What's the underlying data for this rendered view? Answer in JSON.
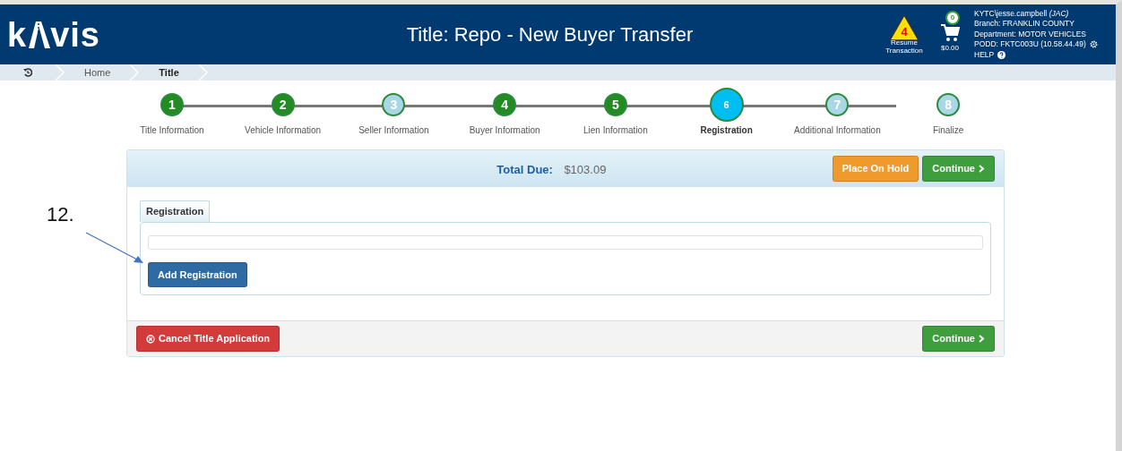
{
  "header": {
    "logo": {
      "before": "k",
      "after": "vis"
    },
    "title": "Title: Repo - New Buyer Transfer",
    "resume": {
      "count": "4",
      "label": "Resume Transaction"
    },
    "cart": {
      "count": "0",
      "amount": "$0.00"
    },
    "user": {
      "name": "KYTC\\jesse.campbell",
      "initials": "(JAC)",
      "branch_label": "Branch:",
      "branch": "FRANKLIN COUNTY",
      "department_label": "Department:",
      "department": "MOTOR VEHICLES",
      "podd_label": "PODD:",
      "podd": "FKTC003U (10.58.44.49)",
      "help": "HELP"
    }
  },
  "breadcrumb": [
    {
      "kind": "history"
    },
    {
      "kind": "link",
      "label": "Home",
      "selected": false
    },
    {
      "kind": "link",
      "label": "Title",
      "selected": true
    }
  ],
  "steps": [
    {
      "number": "1",
      "label": "Title Information",
      "kind": "done",
      "selected": false
    },
    {
      "number": "2",
      "label": "Vehicle Information",
      "kind": "done",
      "selected": false
    },
    {
      "number": "3",
      "label": "Seller Information",
      "kind": "todo",
      "selected": false
    },
    {
      "number": "4",
      "label": "Buyer Information",
      "kind": "done",
      "selected": false
    },
    {
      "number": "5",
      "label": "Lien Information",
      "kind": "done",
      "selected": false
    },
    {
      "number": "6",
      "label": "Registration",
      "kind": "current",
      "selected": true
    },
    {
      "number": "7",
      "label": "Additional Information",
      "kind": "todo",
      "selected": false
    },
    {
      "number": "8",
      "label": "Finalize",
      "kind": "todo",
      "selected": false
    }
  ],
  "panel": {
    "total_label": "Total Due:",
    "total": "$103.09",
    "hold_button": "Place On Hold",
    "continue_button": "Continue",
    "tab": "Registration",
    "add_button": "Add Registration",
    "cancel_button": "Cancel Title Application",
    "footer_continue": "Continue"
  },
  "annotation": {
    "label": "12."
  }
}
